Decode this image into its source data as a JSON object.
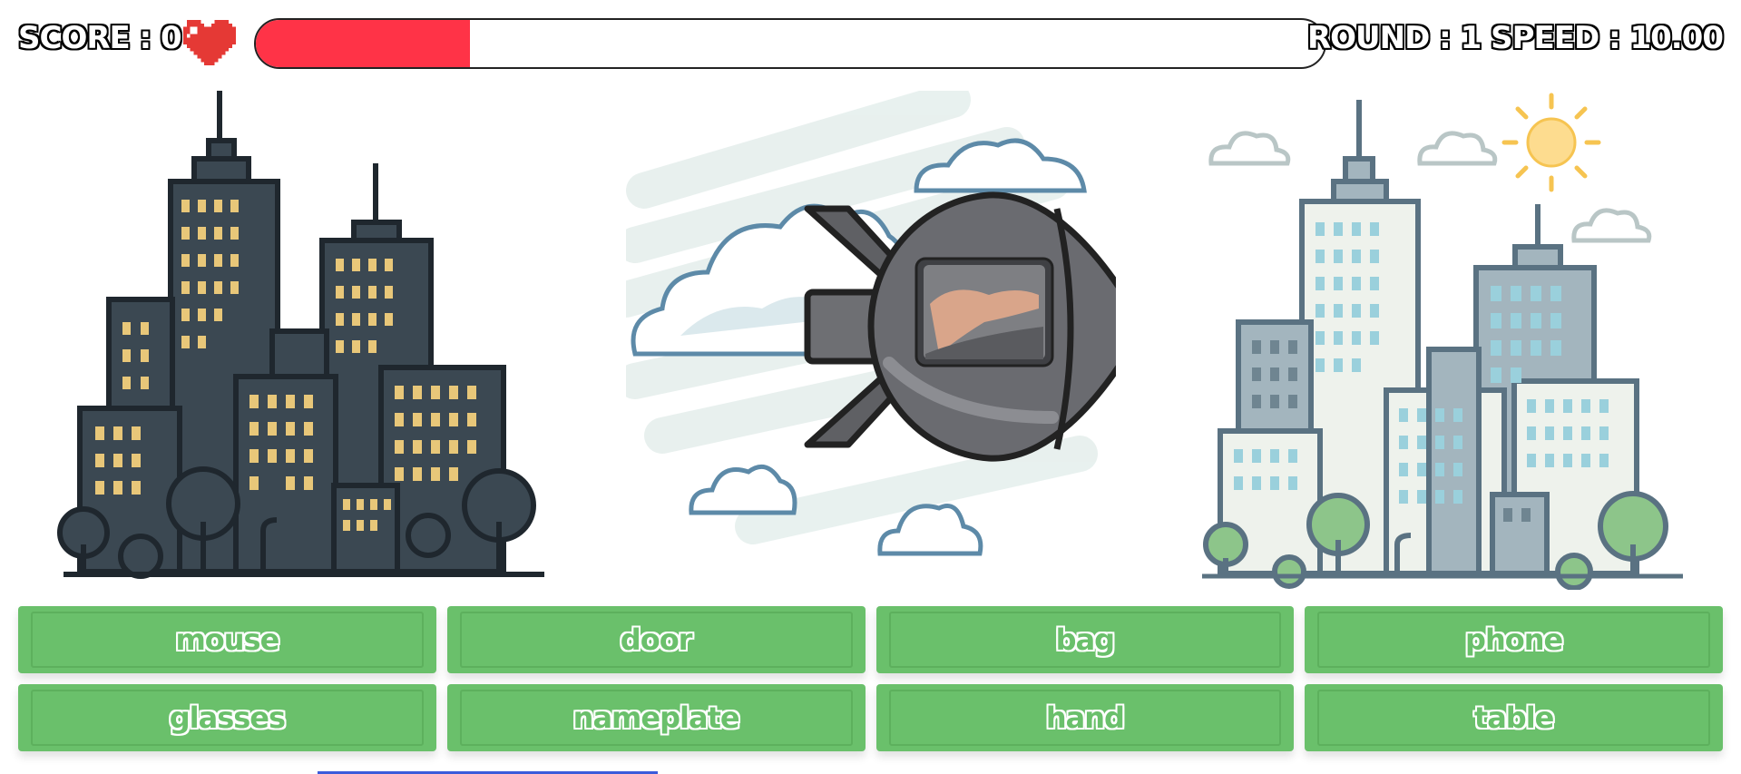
{
  "hud": {
    "score_text": "SCORE : 0",
    "round_speed_text": "ROUND : 1  SPEED : 10.00",
    "life_icon": "heart-icon",
    "timer_progress": 0.2
  },
  "scene": {
    "left_city": "dark-city-illustration",
    "center": "rocket-with-photo",
    "right_city": "light-city-illustration"
  },
  "answers": [
    {
      "label": "mouse"
    },
    {
      "label": "door"
    },
    {
      "label": "bag"
    },
    {
      "label": "phone"
    },
    {
      "label": "glasses"
    },
    {
      "label": "nameplate"
    },
    {
      "label": "hand"
    },
    {
      "label": "table"
    }
  ],
  "colors": {
    "timer_fill": "#ff3347",
    "answer_bg": "#6ac06b",
    "heart": "#e53935"
  }
}
